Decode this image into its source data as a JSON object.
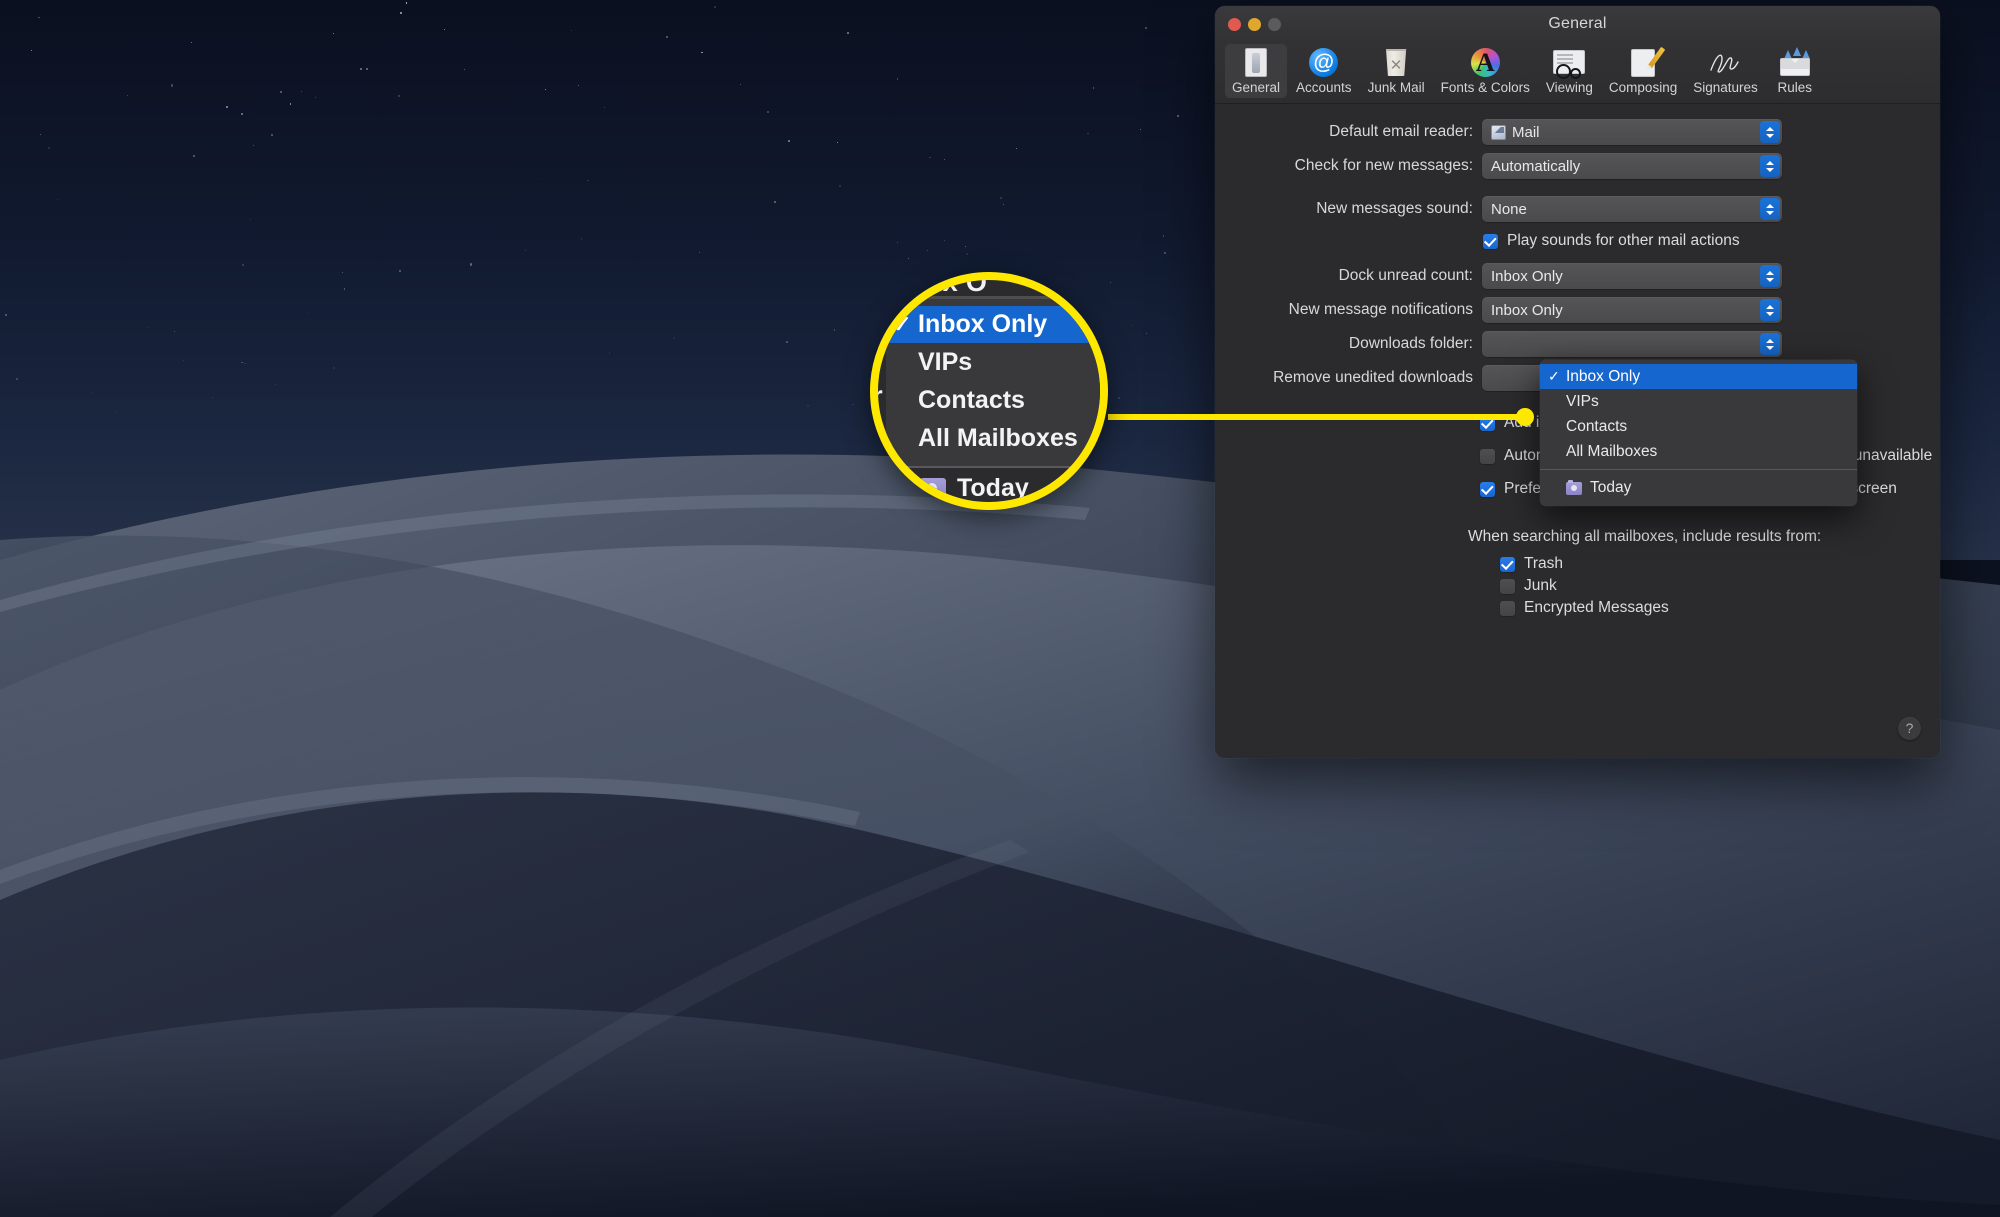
{
  "window": {
    "title": "General",
    "traffic_lights": [
      "close-red",
      "minimize-yellow",
      "zoom-grey-disabled"
    ]
  },
  "toolbar": {
    "items": [
      {
        "label": "General",
        "icon": "general-icon",
        "selected": true
      },
      {
        "label": "Accounts",
        "icon": "accounts-at-icon",
        "selected": false
      },
      {
        "label": "Junk Mail",
        "icon": "junk-mail-trash-icon",
        "selected": false
      },
      {
        "label": "Fonts & Colors",
        "icon": "fonts-colors-icon",
        "selected": false
      },
      {
        "label": "Viewing",
        "icon": "viewing-glasses-icon",
        "selected": false
      },
      {
        "label": "Composing",
        "icon": "composing-pencil-icon",
        "selected": false
      },
      {
        "label": "Signatures",
        "icon": "signatures-icon",
        "selected": false
      },
      {
        "label": "Rules",
        "icon": "rules-envelope-icon",
        "selected": false
      }
    ]
  },
  "settings": {
    "default_email_reader": {
      "label": "Default email reader:",
      "value": "Mail",
      "icon": "mail-app-icon"
    },
    "check_for_new_messages": {
      "label": "Check for new messages:",
      "value": "Automatically"
    },
    "new_messages_sound": {
      "label": "New messages sound:",
      "value": "None"
    },
    "play_sounds": {
      "label": "Play sounds for other mail actions",
      "checked": true
    },
    "dock_unread_count": {
      "label": "Dock unread count:",
      "value": "Inbox Only"
    },
    "new_message_notifications": {
      "label": "New message notifications",
      "value": "Inbox Only"
    },
    "downloads_folder": {
      "label": "Downloads folder:"
    },
    "remove_unedited_downloads": {
      "label": "Remove unedited downloads"
    }
  },
  "checkboxes": [
    {
      "label": "Add invitations to Calendar automatically",
      "checked": true
    },
    {
      "label": "Automatically try sending later if outgoing server is unavailable",
      "checked": false
    },
    {
      "label": "Prefer opening messages in split view when in full screen",
      "checked": true
    }
  ],
  "search_section": {
    "title": "When searching all mailboxes, include results from:",
    "options": [
      {
        "label": "Trash",
        "checked": true
      },
      {
        "label": "Junk",
        "checked": false
      },
      {
        "label": "Encrypted Messages",
        "checked": false
      }
    ]
  },
  "open_menu": {
    "items": [
      {
        "label": "Inbox Only",
        "checked": true,
        "highlighted": true
      },
      {
        "label": "VIPs",
        "checked": false,
        "highlighted": false
      },
      {
        "label": "Contacts",
        "checked": false,
        "highlighted": false
      },
      {
        "label": "All Mailboxes",
        "checked": false,
        "highlighted": false
      }
    ],
    "separator_item": {
      "label": "Today",
      "icon": "today-folder-icon"
    },
    "checkmark_glyph": "✓"
  },
  "magnifier": {
    "partial_top_text": "ox O",
    "partial_left_text": "er",
    "items": [
      {
        "label": "Inbox Only",
        "checked": true,
        "highlighted": true
      },
      {
        "label": "VIPs",
        "checked": false,
        "highlighted": false
      },
      {
        "label": "Contacts",
        "checked": false,
        "highlighted": false
      },
      {
        "label": "All Mailboxes",
        "checked": false,
        "highlighted": false
      }
    ],
    "today_label": "Today",
    "checkmark_glyph": "✓"
  },
  "help_button": {
    "glyph": "?"
  },
  "colors": {
    "accent_blue": "#1566cf",
    "callout_yellow": "#ffe800",
    "window_bg": "#2b2b2d",
    "menu_bg": "#39393b",
    "popup_bg": "#4f4f51"
  }
}
